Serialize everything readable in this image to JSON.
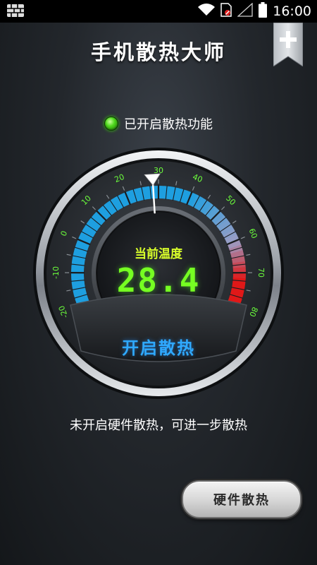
{
  "status_bar": {
    "time": "16:00",
    "icons": [
      "app-grid-icon",
      "wifi-icon",
      "sim-blocked-icon",
      "signal-icon",
      "battery-icon"
    ]
  },
  "header": {
    "title": "手机散热大师",
    "add_icon": "plus-icon"
  },
  "cooling_status": {
    "text": "已开启散热功能",
    "indicator_color": "#3fd11a"
  },
  "gauge": {
    "label": "当前温度",
    "value": "28.4",
    "reading": 28.4,
    "ticks": [
      "-20",
      "-10",
      "0",
      "10",
      "20",
      "30",
      "40",
      "50",
      "60",
      "70",
      "80"
    ],
    "range": [
      -20,
      80
    ],
    "button_label": "开启散热",
    "colors": {
      "cool": "#1e9fe0",
      "mid": "#9a9ec6",
      "hot": "#e01818",
      "value": "#76ff22",
      "label": "#d9ff2a",
      "tick_text": "#6cff3c"
    }
  },
  "hint_text": "未开启硬件散热，可进一步散热",
  "hardware_button": {
    "label": "硬件散热"
  }
}
